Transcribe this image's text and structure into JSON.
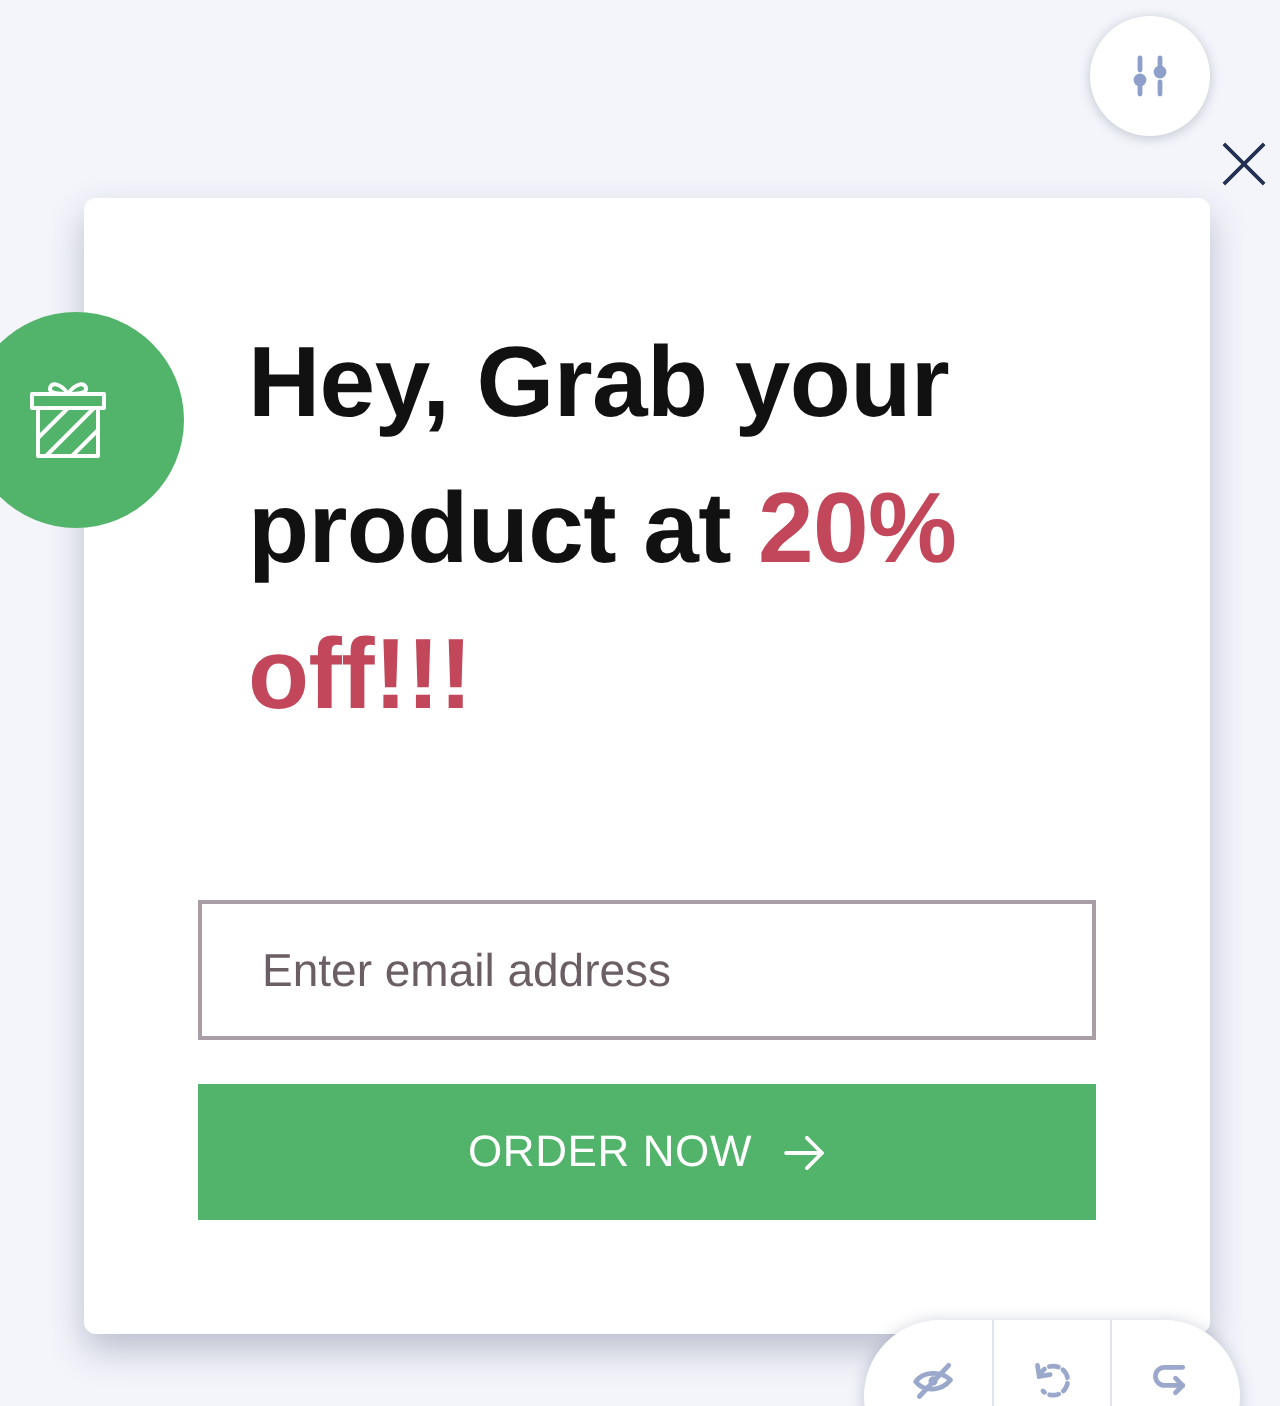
{
  "popup": {
    "heading": {
      "text": "Hey, Grab your product at",
      "highlight": "20% off!!!"
    },
    "email_field": {
      "placeholder": "Enter email address"
    },
    "order_button": {
      "label": "ORDER NOW"
    }
  }
}
